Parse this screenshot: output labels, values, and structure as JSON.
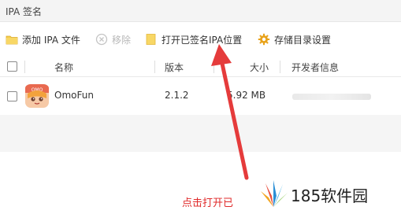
{
  "window": {
    "title": "IPA 签名"
  },
  "toolbar": {
    "add_label": "添加 IPA 文件",
    "remove_label": "移除",
    "open_signed_label": "打开已签名IPA位置",
    "storage_dir_label": "存储目录设置"
  },
  "table": {
    "columns": {
      "name": "名称",
      "version": "版本",
      "size": "大小",
      "developer": "开发者信息"
    },
    "rows": [
      {
        "name": "OmoFun",
        "version": "2.1.2",
        "size": "5.92 MB",
        "developer": ""
      }
    ]
  },
  "annotation": {
    "caption": "点击打开已",
    "color": "#e02b2b"
  },
  "watermark": {
    "text": "185软件园"
  },
  "colors": {
    "accent_folder": "#f5cd4c",
    "gear": "#e8a21a",
    "arrow": "#e53b3b"
  }
}
